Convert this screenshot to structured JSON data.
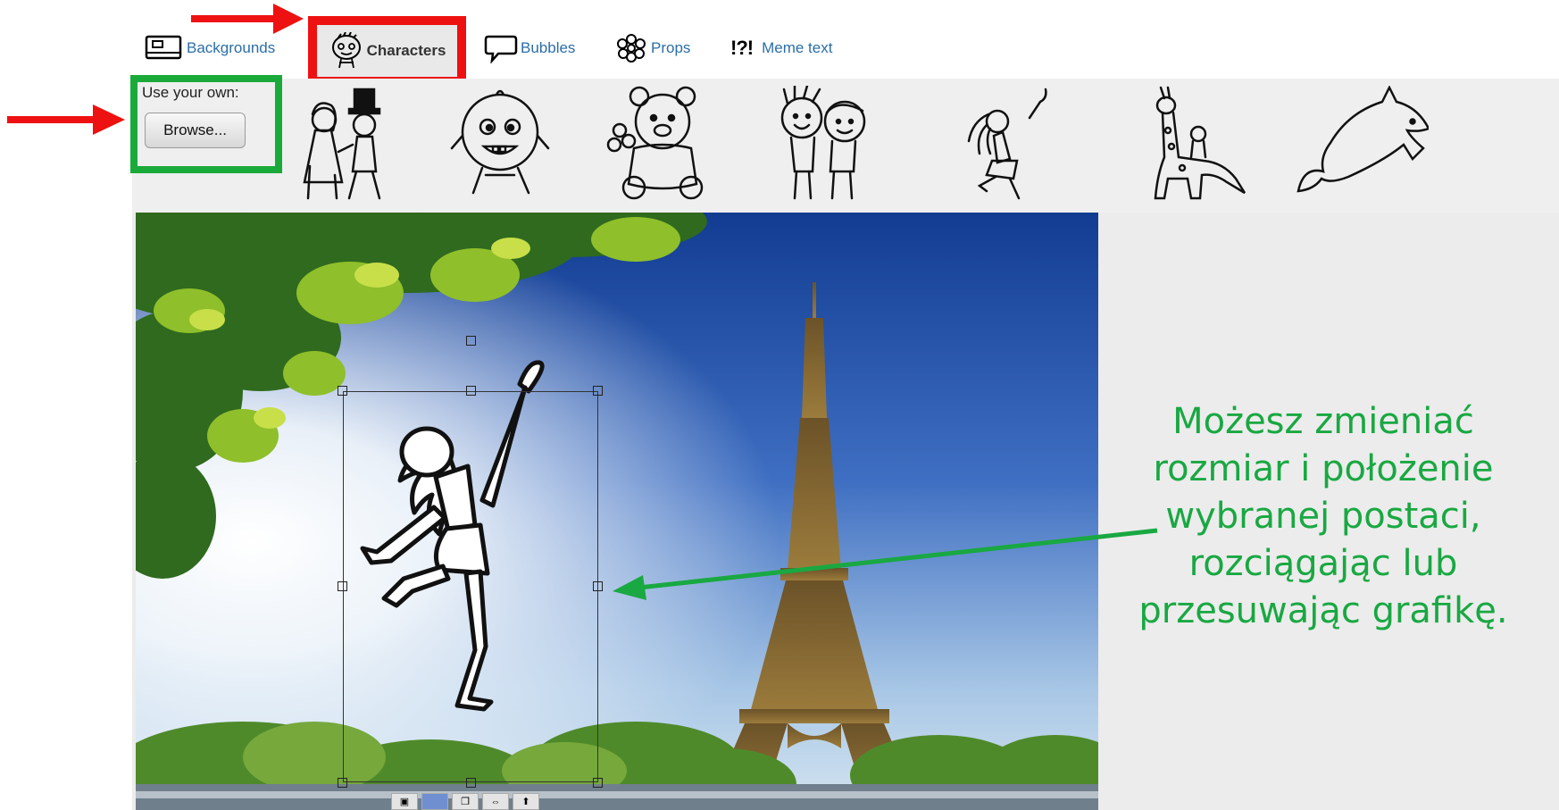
{
  "tabs": {
    "backgrounds": "Backgrounds",
    "characters": "Characters",
    "bubbles": "Bubbles",
    "props": "Props",
    "meme_icon": "!?!",
    "meme": "Meme text"
  },
  "upload": {
    "label": "Use your own:",
    "button": "Browse..."
  },
  "characters": [
    "couple-wedding",
    "baby",
    "teddy-bear",
    "two-boys",
    "dancing-girl",
    "giraffe",
    "dolphin"
  ],
  "annotation": {
    "text": "Możesz zmieniać rozmiar i położenie wybranej postaci, rozciągając lub przesuwając grafikę."
  },
  "colors": {
    "highlight_red": "#ee1111",
    "highlight_green": "#1aaa3a",
    "annotation_green": "#19a842",
    "link_blue": "#2a6ea8"
  }
}
